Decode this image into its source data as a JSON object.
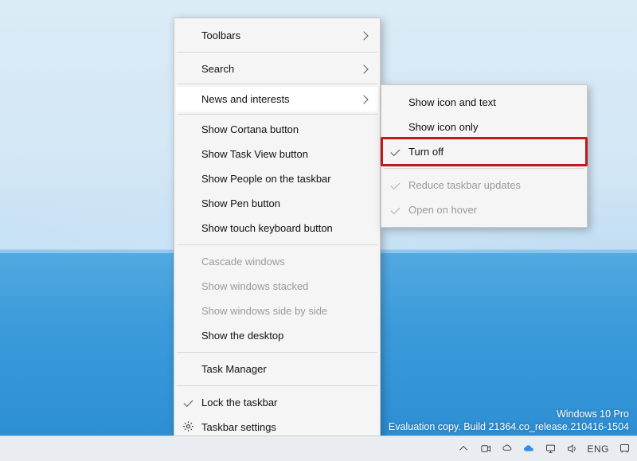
{
  "menu": {
    "toolbars": "Toolbars",
    "search": "Search",
    "news_interests": "News and interests",
    "show_cortana": "Show Cortana button",
    "show_taskview": "Show Task View button",
    "show_people": "Show People on the taskbar",
    "show_pen": "Show Pen button",
    "show_touchkb": "Show touch keyboard button",
    "cascade": "Cascade windows",
    "stacked": "Show windows stacked",
    "sidebyside": "Show windows side by side",
    "show_desktop": "Show the desktop",
    "task_manager": "Task Manager",
    "lock_taskbar": "Lock the taskbar",
    "taskbar_settings": "Taskbar settings"
  },
  "submenu": {
    "icon_text": "Show icon and text",
    "icon_only": "Show icon only",
    "turn_off": "Turn off",
    "reduce_updates": "Reduce taskbar updates",
    "open_hover": "Open on hover"
  },
  "eval": {
    "line1": "Windows 10 Pro",
    "line2": "Evaluation copy. Build 21364.co_release.210416-1504"
  },
  "tray": {
    "lang": "ENG"
  }
}
